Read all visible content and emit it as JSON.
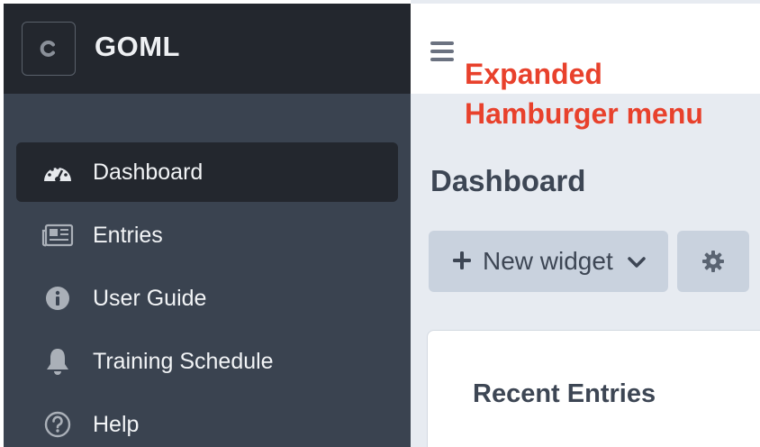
{
  "app": {
    "name": "GOML",
    "logo_letter": "C"
  },
  "sidebar": {
    "items": [
      {
        "label": "Dashboard",
        "icon": "dashboard-gauge-icon",
        "active": true
      },
      {
        "label": "Entries",
        "icon": "newspaper-icon",
        "active": false
      },
      {
        "label": "User Guide",
        "icon": "info-circle-icon",
        "active": false
      },
      {
        "label": "Training Schedule",
        "icon": "bell-icon",
        "active": false
      },
      {
        "label": "Help",
        "icon": "question-circle-icon",
        "active": false
      }
    ]
  },
  "topbar": {
    "menu_icon": "hamburger-icon"
  },
  "annotation": {
    "line1": "Expanded",
    "line2": "Hamburger menu",
    "color": "#e8412c"
  },
  "main": {
    "title": "Dashboard",
    "new_widget_label": "New widget",
    "settings_icon": "gear-icon",
    "card_title": "Recent Entries"
  },
  "colors": {
    "sidebar_bg": "#3a4350",
    "sidebar_header_bg": "#23272e",
    "active_item_bg": "#23272e",
    "main_bg": "#e7ebf1",
    "button_bg": "#c9d2de"
  }
}
